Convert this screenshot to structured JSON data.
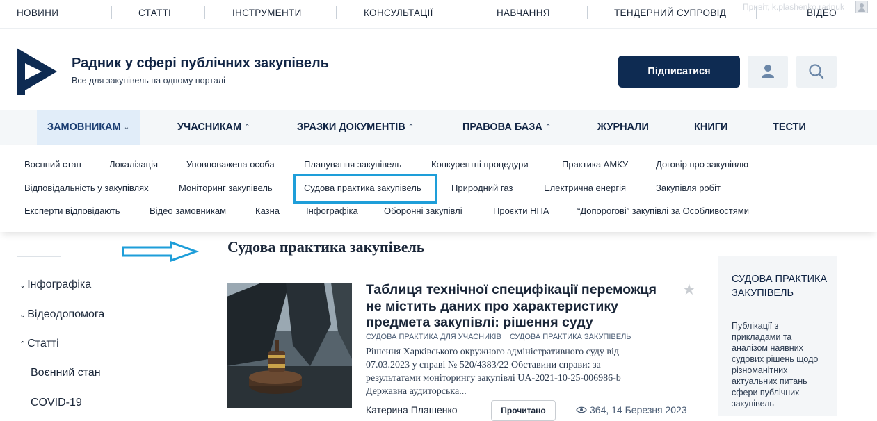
{
  "topnav": {
    "items": [
      "НОВИНИ",
      "СТАТТІ",
      "ІНСТРУМЕНТИ",
      "КОНСУЛЬТАЦІЇ",
      "НАВЧАННЯ",
      "ТЕНДЕРНИЙ СУПРОВІД",
      "ВІДЕО"
    ],
    "greeting": "Привіт, k.plashenko.radnuk"
  },
  "header": {
    "title": "Радник у сфері публічних закупівель",
    "subtitle": "Все для закупівель на одному порталі",
    "subscribe_label": "Підписатися"
  },
  "mainnav": {
    "items": [
      "ЗАМОВНИКАМ",
      "УЧАСНИКАМ",
      "ЗРАЗКИ ДОКУМЕНТІВ",
      "ПРАВОВА БАЗА",
      "ЖУРНАЛИ",
      "КНИГИ",
      "ТЕСТИ"
    ]
  },
  "submenu": {
    "row1": [
      "Воєнний стан",
      "Локалізація",
      "Уповноважена особа",
      "Планування закупівель",
      "Конкурентні процедури",
      "Практика АМКУ",
      "Договір про закупівлю"
    ],
    "row2": [
      "Відповідальність у закупівлях",
      "Моніторинг закупівель",
      "Судова практика закупівель",
      "Природний газ",
      "Електрична енергія",
      "Закупівля робіт"
    ],
    "row3": [
      "Експерти відповідають",
      "Відео замовникам",
      "Казна",
      "Інфографіка",
      "Оборонні закупівлі",
      "Проєкти НПА",
      "“Допорогові” закупівлі за Особливостями"
    ]
  },
  "sidebar": {
    "items": [
      "Інфографіка",
      "Відеодопомога",
      "Статті",
      "Воєнний стан",
      "COVID-19"
    ]
  },
  "page": {
    "title": "Судова практика закупівель"
  },
  "article": {
    "title": "Таблиця технічної специфікації переможця не містить даних про характеристику предмета закупівлі: рішення суду",
    "tags": [
      "СУДОВА ПРАКТИКА ДЛЯ УЧАСНИКІВ",
      "СУДОВА ПРАКТИКА ЗАКУПІВЕЛЬ"
    ],
    "excerpt": "Рішення Харківського окружного адміністративного суду від 07.03.2023 у справі № 520/4383/22 Обставини справи: за результатами моніторингу закупівлі UA-2021-10-25-006986-b Державна аудиторська...",
    "author": "Катерина Плашенко",
    "read_label": "Прочитано",
    "views": "364",
    "date": "14 Березня 2023"
  },
  "rightbox": {
    "title": "СУДОВА ПРАКТИКА ЗАКУПІВЕЛЬ",
    "text": "Публікації з прикладами та аналізом наявних судових рішень щодо різноманітних актуальних питань сфери публічних закупівель"
  },
  "colors": {
    "brand": "#0e2b52",
    "highlight": "#1e9ed9",
    "nav_bg": "#f4f7f9"
  }
}
